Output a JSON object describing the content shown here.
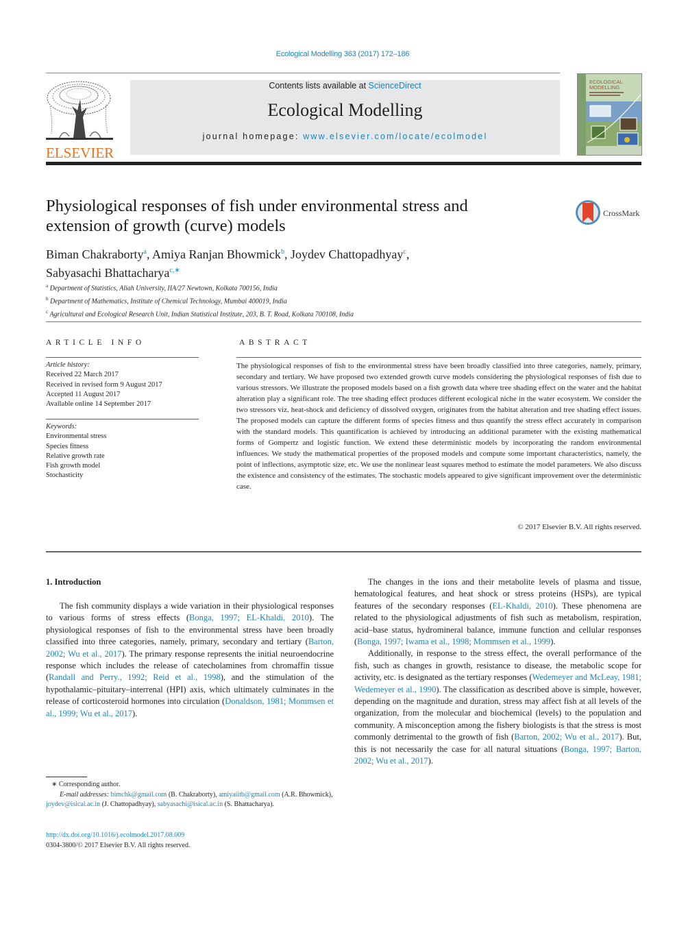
{
  "header": {
    "journal_reference": "Ecological Modelling 363 (2017) 172–186",
    "contents_prefix": "Contents lists available at ",
    "contents_link": "ScienceDirect",
    "journal_title": "Ecological Modelling",
    "homepage_prefix": "journal homepage: ",
    "homepage_link": "www.elsevier.com/locate/ecolmodel",
    "publisher_logo_text": "ELSEVIER",
    "cover_title": "ECOLOGICAL MODELLING",
    "crossmark_label": "CrossMark"
  },
  "article": {
    "title_line1": "Physiological responses of fish under environmental stress and",
    "title_line2": "extension of growth (curve) models",
    "authors": [
      {
        "name": "Biman Chakraborty",
        "sup": "a",
        "sep": ", "
      },
      {
        "name": "Amiya Ranjan Bhowmick",
        "sup": "b",
        "sep": ", "
      },
      {
        "name": "Joydev Chattopadhyay",
        "sup": "c",
        "sep": ","
      },
      {
        "name": "Sabyasachi Bhattacharya",
        "sup": "c,∗",
        "sep": ""
      }
    ],
    "affiliations": [
      {
        "sup": "a",
        "text": "Department of Statistics, Aliah University, IIA/27 Newtown, Kolkata 700156, India"
      },
      {
        "sup": "b",
        "text": "Department of Mathematics, Institute of Chemical Technology, Mumbai 400019, India"
      },
      {
        "sup": "c",
        "text": "Agricultural and Ecological Research Unit, Indian Statistical Institute, 203, B. T. Road, Kolkata 700108, India"
      }
    ]
  },
  "article_info": {
    "heading": "ARTICLE INFO",
    "history_label": "Article history:",
    "history": [
      "Received 22 March 2017",
      "Received in revised form 9 August 2017",
      "Accepted 11 August 2017",
      "Available online 14 September 2017"
    ],
    "keywords_label": "Keywords:",
    "keywords": [
      "Environmental stress",
      "Species fitness",
      "Relative growth rate",
      "Fish growth model",
      "Stochasticity"
    ]
  },
  "abstract": {
    "heading": "ABSTRACT",
    "text": "The physiological responses of fish to the environmental stress have been broadly classified into three categories, namely, primary, secondary and tertiary. We have proposed two extended growth curve models considering the physiological responses of fish due to various stressors. We illustrate the proposed models based on a fish growth data where tree shading effect on the water and the habitat alteration play a significant role. The tree shading effect produces different ecological niche in the water ecosystem. We consider the two stressors viz. heat-shock and deficiency of dissolved oxygen, originates from the habitat alteration and tree shading effect issues. The proposed models can capture the different forms of species fitness and thus quantify the stress effect accurately in comparison with the standard models. This quantification is achieved by introducing an additional parameter with the existing mathematical forms of Gompertz and logistic function. We extend these deterministic models by incorporating the random environmental influences. We study the mathematical properties of the proposed models and compute some important characteristics, namely, the point of inflections, asymptotic size, etc. We use the nonlinear least squares method to estimate the model parameters. We also discuss the existence and consistency of the estimates. The stochastic models appeared to give significant improvement over the deterministic case.",
    "copyright": "© 2017 Elsevier B.V. All rights reserved."
  },
  "introduction": {
    "heading": "1.  Introduction",
    "paragraphs": [
      [
        {
          "t": "The fish community displays a wide variation in their physiological responses to various forms of stress effects ("
        },
        {
          "t": "Bonga, 1997; EL-Khaldi, 2010",
          "link": true
        },
        {
          "t": "). The physiological responses of fish to the environmental stress have been broadly classified into three categories, namely, primary, secondary and tertiary ("
        },
        {
          "t": "Barton, 2002; Wu et al., 2017",
          "link": true
        },
        {
          "t": "). The primary response represents the initial neuroendocrine response which includes the release of catecholamines from chromaffin tissue ("
        },
        {
          "t": "Randall and Perry., 1992; Reid et al., 1998",
          "link": true
        },
        {
          "t": "), and the stimulation of the hypothalamic–pituitary–interrenal (HPI) axis, which ultimately culminates in the release of corticosteroid hormones into circulation ("
        },
        {
          "t": "Donaldson, 1981; Mommsen et al., 1999; Wu et al., 2017",
          "link": true
        },
        {
          "t": ")."
        }
      ],
      [
        {
          "t": "The changes in the ions and their metabolite levels of plasma and tissue, hematological features, and heat shock or stress proteins (HSPs), are typical features of the secondary responses ("
        },
        {
          "t": "EL-Khaldi, 2010",
          "link": true
        },
        {
          "t": "). These phenomena are related to the physiological adjustments of fish such as metabolism, respiration, acid–base status, hydromineral balance, immune function and cellular responses ("
        },
        {
          "t": "Bonga, 1997; Iwama et al., 1998; Mommsen et al., 1999",
          "link": true
        },
        {
          "t": ")."
        }
      ],
      [
        {
          "t": "Additionally, in response to the stress effect, the overall performance of the fish, such as changes in growth, resistance to disease, the metabolic scope for activity, etc. is designated as the tertiary responses ("
        },
        {
          "t": "Wedemeyer and McLeay, 1981; Wedemeyer et al., 1990",
          "link": true
        },
        {
          "t": "). The classification as described above is simple, however, depending on the magnitude and duration, stress may affect fish at all levels of the organization, from the molecular and biochemical (levels) to the population and community. A misconception among the fishery biologists is that the stress is most commonly detrimental to the growth of fish ("
        },
        {
          "t": "Barton, 2002; Wu et al., 2017",
          "link": true
        },
        {
          "t": "). But, this is not necessarily the case for all natural situations ("
        },
        {
          "t": "Bonga, 1997; Barton, 2002; Wu et al., 2017",
          "link": true
        },
        {
          "t": ")."
        }
      ]
    ]
  },
  "footnote": {
    "corresponding": "∗  Corresponding author.",
    "email_label": "E-mail addresses:",
    "emails": [
      {
        "email": "bimchk@gmail.com",
        "name": " (B. Chakraborty), "
      },
      {
        "email": "amiyaiitb@gmail.com",
        "name": " (A.R. Bhowmick), "
      },
      {
        "email": "joydev@isical.ac.in",
        "name": " (J. Chattopadhyay), "
      },
      {
        "email": "sabyasachi@isical.ac.in",
        "name": " (S. Bhattacharya)."
      }
    ],
    "doi": "http://dx.doi.org/10.1016/j.ecolmodel.2017.08.009",
    "issn": "0304-3800/© 2017 Elsevier B.V. All rights reserved."
  },
  "colors": {
    "link": "#1a85b8",
    "elsevier_orange": "#e9711c",
    "masthead_bg": "#e6e7e8"
  }
}
